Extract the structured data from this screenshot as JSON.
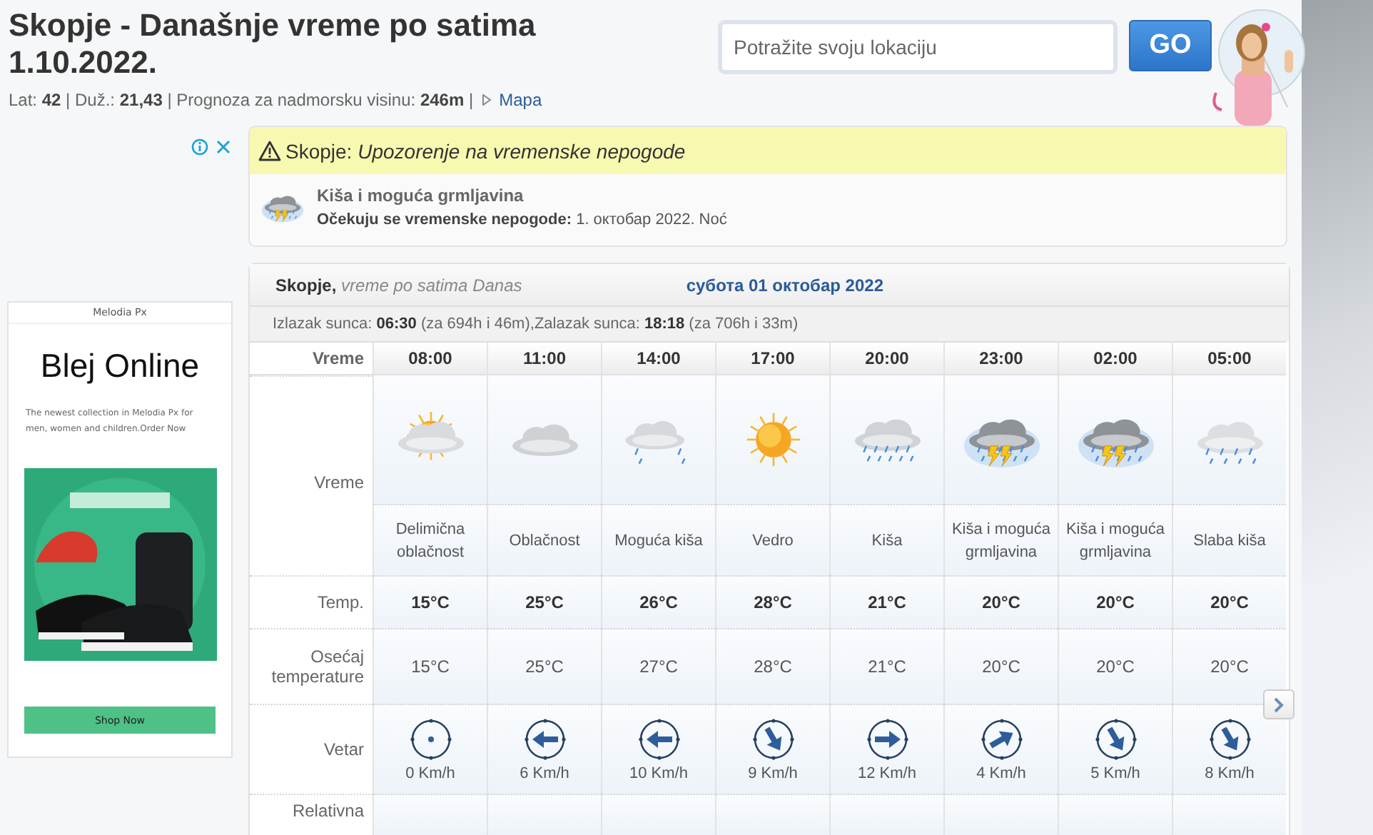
{
  "header": {
    "title": "Skopje - Današnje vreme po satima 1.10.2022.",
    "meta": "Lat: **42** | Duž.: **21,43** | Prognoza za nadmorsku visinu: **246m** |",
    "map_link": "Mapa",
    "search": {
      "placeholder": "Potražite svoju lokaciju"
    },
    "go_button": "GO"
  },
  "ad": {
    "sponsor": "Melodia Px",
    "headline": "Blej Online",
    "text": "The newest collection in Melodia Px for men, women and children.Order Now",
    "button": "Shop Now"
  },
  "alert": {
    "title": "Skopje: *Upozorenje na vremenske nepogode*",
    "event": "Kiša i moguća grmljavina",
    "detail": "**Očekuju se vremenske nepogode:** 1. октобар 2022. Noć"
  },
  "forecast": {
    "place": "**Skopje,** *vreme po satima Danas*",
    "date": "субота 01 октобар 2022",
    "sun": "Izlazak sunca: **06:30** (za 694h i 46m),Zalazak sunca: **18:18** (za 706h i 33m)",
    "row_labels": {
      "corner": "Vreme",
      "weather": "Vreme",
      "temp": "Temp.",
      "feels": "Osećaj temperature",
      "wind": "Vetar",
      "humidity": "Relativna"
    },
    "columns": [
      {
        "time": "08:00",
        "kind": "partly_cloudy",
        "desc": "Delimična oblačnost",
        "temp": "15°C",
        "feels": "15°C",
        "wind": {
          "kind": "calm",
          "speed": "0 Km/h"
        }
      },
      {
        "time": "11:00",
        "kind": "cloudy",
        "desc": "Oblačnost",
        "temp": "25°C",
        "feels": "25°C",
        "wind": {
          "kind": "west",
          "speed": "6 Km/h"
        }
      },
      {
        "time": "14:00",
        "kind": "possible_rain",
        "desc": "Moguća kiša",
        "temp": "26°C",
        "feels": "27°C",
        "wind": {
          "kind": "west",
          "speed": "10 Km/h"
        }
      },
      {
        "time": "17:00",
        "kind": "sunny",
        "desc": "Vedro",
        "temp": "28°C",
        "feels": "28°C",
        "wind": {
          "kind": "southeast",
          "speed": "9 Km/h"
        }
      },
      {
        "time": "20:00",
        "kind": "rain",
        "desc": "Kiša",
        "temp": "21°C",
        "feels": "21°C",
        "wind": {
          "kind": "east",
          "speed": "12 Km/h"
        }
      },
      {
        "time": "23:00",
        "kind": "thunderstorm",
        "desc": "Kiša i moguća grmljavina",
        "temp": "20°C",
        "feels": "20°C",
        "wind": {
          "kind": "northeast",
          "speed": "4 Km/h"
        }
      },
      {
        "time": "02:00",
        "kind": "thunderstorm",
        "desc": "Kiša i moguća grmljavina",
        "temp": "20°C",
        "feels": "20°C",
        "wind": {
          "kind": "southeast",
          "speed": "5 Km/h"
        }
      },
      {
        "time": "05:00",
        "kind": "light_rain",
        "desc": "Slaba kiša",
        "temp": "20°C",
        "feels": "20°C",
        "wind": {
          "kind": "southeast",
          "speed": "8 Km/h"
        }
      }
    ]
  }
}
